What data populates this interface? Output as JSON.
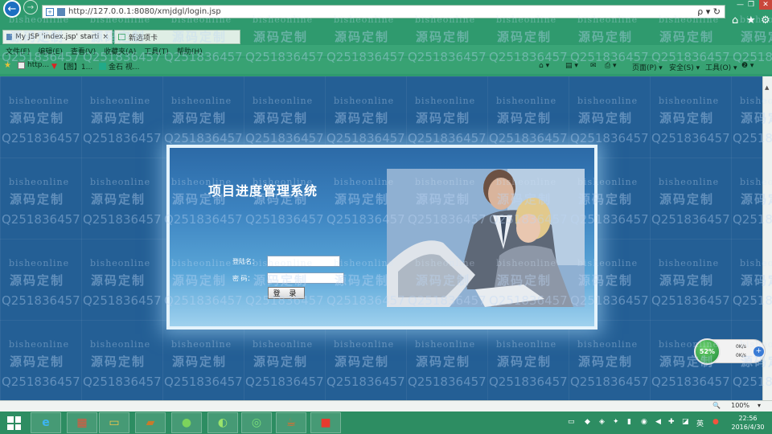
{
  "browser": {
    "address_url": "http://127.0.0.1:8080/xmjdgl/login.jsp",
    "search_glyph": "ρ",
    "refresh_glyph": "↻",
    "tabs": [
      {
        "label": "My JSP 'index.jsp' startin...",
        "close": "×"
      },
      {
        "label": "新选项卡"
      }
    ],
    "menu": [
      "文件(F)",
      "编辑(E)",
      "查看(V)",
      "收藏夹(A)",
      "工具(T)",
      "帮助(H)"
    ],
    "favorites": [
      "http...",
      "【图】1...",
      "金石 视..."
    ],
    "commands": [
      "页面(P) ▾",
      "安全(S) ▾",
      "工具(O) ▾",
      "❷ ▾"
    ]
  },
  "page": {
    "system_title": "项目进度管理系统",
    "username_label": "登陆名：",
    "password_label": "密  码：",
    "username_value": "",
    "password_value": "",
    "login_button": "登 录"
  },
  "status": {
    "zoom": "100%"
  },
  "speed_widget": {
    "percent": "52%",
    "up": "0K/s",
    "down": "0K/s"
  },
  "taskbar": {
    "time": "22:56",
    "date": "2016/4/30",
    "ime": "英"
  },
  "watermark": {
    "online": "bisheonline",
    "custom": "源码定制",
    "qq": "Q251836457"
  },
  "colors": {
    "chrome_green": "#2f9a6e",
    "page_blue": "#245f95",
    "start_blue": "#1d6fc1"
  }
}
